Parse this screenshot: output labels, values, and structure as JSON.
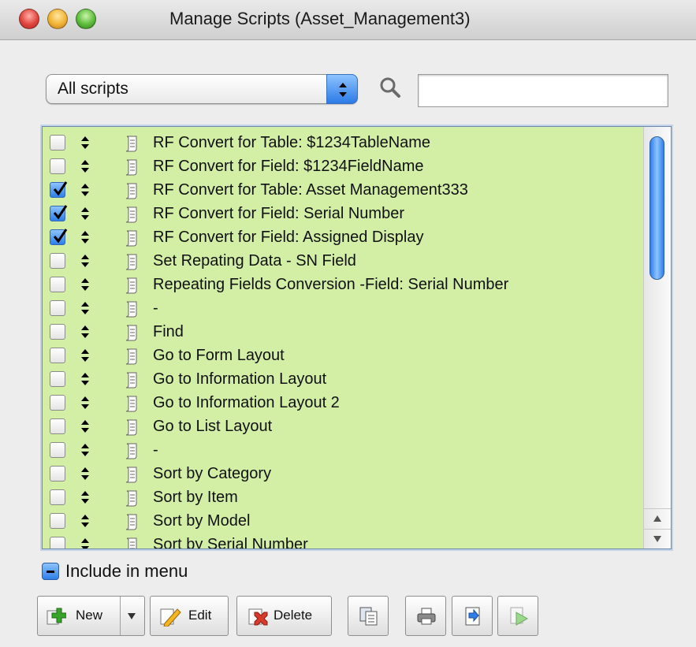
{
  "window": {
    "title": "Manage Scripts (Asset_Management3)"
  },
  "filter": {
    "selected": "All scripts",
    "search_value": "",
    "search_placeholder": ""
  },
  "scripts": [
    {
      "name": "RF Convert for Table: $1234TableName",
      "checked": false
    },
    {
      "name": "RF Convert for Field: $1234FieldName",
      "checked": false
    },
    {
      "name": "RF Convert for Table: Asset Management333",
      "checked": true
    },
    {
      "name": "RF Convert for Field: Serial Number",
      "checked": true
    },
    {
      "name": "RF Convert for Field: Assigned Display",
      "checked": true
    },
    {
      "name": "Set Repating Data - SN Field",
      "checked": false
    },
    {
      "name": "Repeating Fields Conversion -Field: Serial Number",
      "checked": false
    },
    {
      "name": "-",
      "checked": false
    },
    {
      "name": "Find",
      "checked": false
    },
    {
      "name": "Go to Form Layout",
      "checked": false
    },
    {
      "name": "Go to Information Layout",
      "checked": false
    },
    {
      "name": "Go to Information Layout 2",
      "checked": false
    },
    {
      "name": "Go to List Layout",
      "checked": false
    },
    {
      "name": "-",
      "checked": false
    },
    {
      "name": "Sort by Category",
      "checked": false
    },
    {
      "name": "Sort by Item",
      "checked": false
    },
    {
      "name": "Sort by Model",
      "checked": false
    },
    {
      "name": "Sort by Serial Number",
      "checked": false
    }
  ],
  "include_in_menu": {
    "label": "Include in menu",
    "state": "mixed"
  },
  "buttons": {
    "new": "New",
    "edit": "Edit",
    "delete": "Delete"
  },
  "colors": {
    "list_background": "#d3efa5",
    "selection_blue": "#2e7fe7"
  },
  "icons": {
    "search": "magnifier-icon",
    "script": "script-document-icon",
    "handle": "reorder-handle-icon"
  }
}
